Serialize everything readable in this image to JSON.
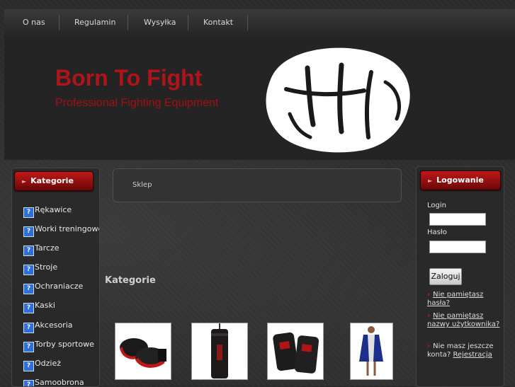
{
  "nav": {
    "items": [
      {
        "label": "O nas"
      },
      {
        "label": "Regulamin"
      },
      {
        "label": "Wysyłka"
      },
      {
        "label": "Kontakt"
      }
    ]
  },
  "banner": {
    "title": "Born To Fight",
    "subtitle": "Professional Fighting Equipment"
  },
  "categories_box": {
    "header": "Kategorie",
    "icon_glyph": "?",
    "items": [
      {
        "label": "Rękawice"
      },
      {
        "label": "Worki treningowe"
      },
      {
        "label": "Tarcze"
      },
      {
        "label": "Stroje"
      },
      {
        "label": "Ochraniacze"
      },
      {
        "label": "Kaski"
      },
      {
        "label": "Akcesoria"
      },
      {
        "label": "Torby sportowe"
      },
      {
        "label": "Odzież"
      },
      {
        "label": "Samoobrona"
      }
    ]
  },
  "breadcrumb": {
    "label": "Sklep"
  },
  "main": {
    "section_title": "Kategorie"
  },
  "login_box": {
    "header": "Logowanie",
    "login_label": "Login",
    "password_label": "Hasło",
    "submit_label": "Zaloguj",
    "links": [
      {
        "prefix": "",
        "text": "Nie pamiętasz hasła?"
      },
      {
        "prefix": "",
        "text": "Nie pamiętasz nazwy użytkownika?"
      },
      {
        "prefix": "Nie masz jeszcze konta?",
        "text": "Rejestracja"
      }
    ]
  },
  "colors": {
    "brand_red": "#b0141a",
    "header_red": "#c01818",
    "background": "#2b2b2b"
  }
}
